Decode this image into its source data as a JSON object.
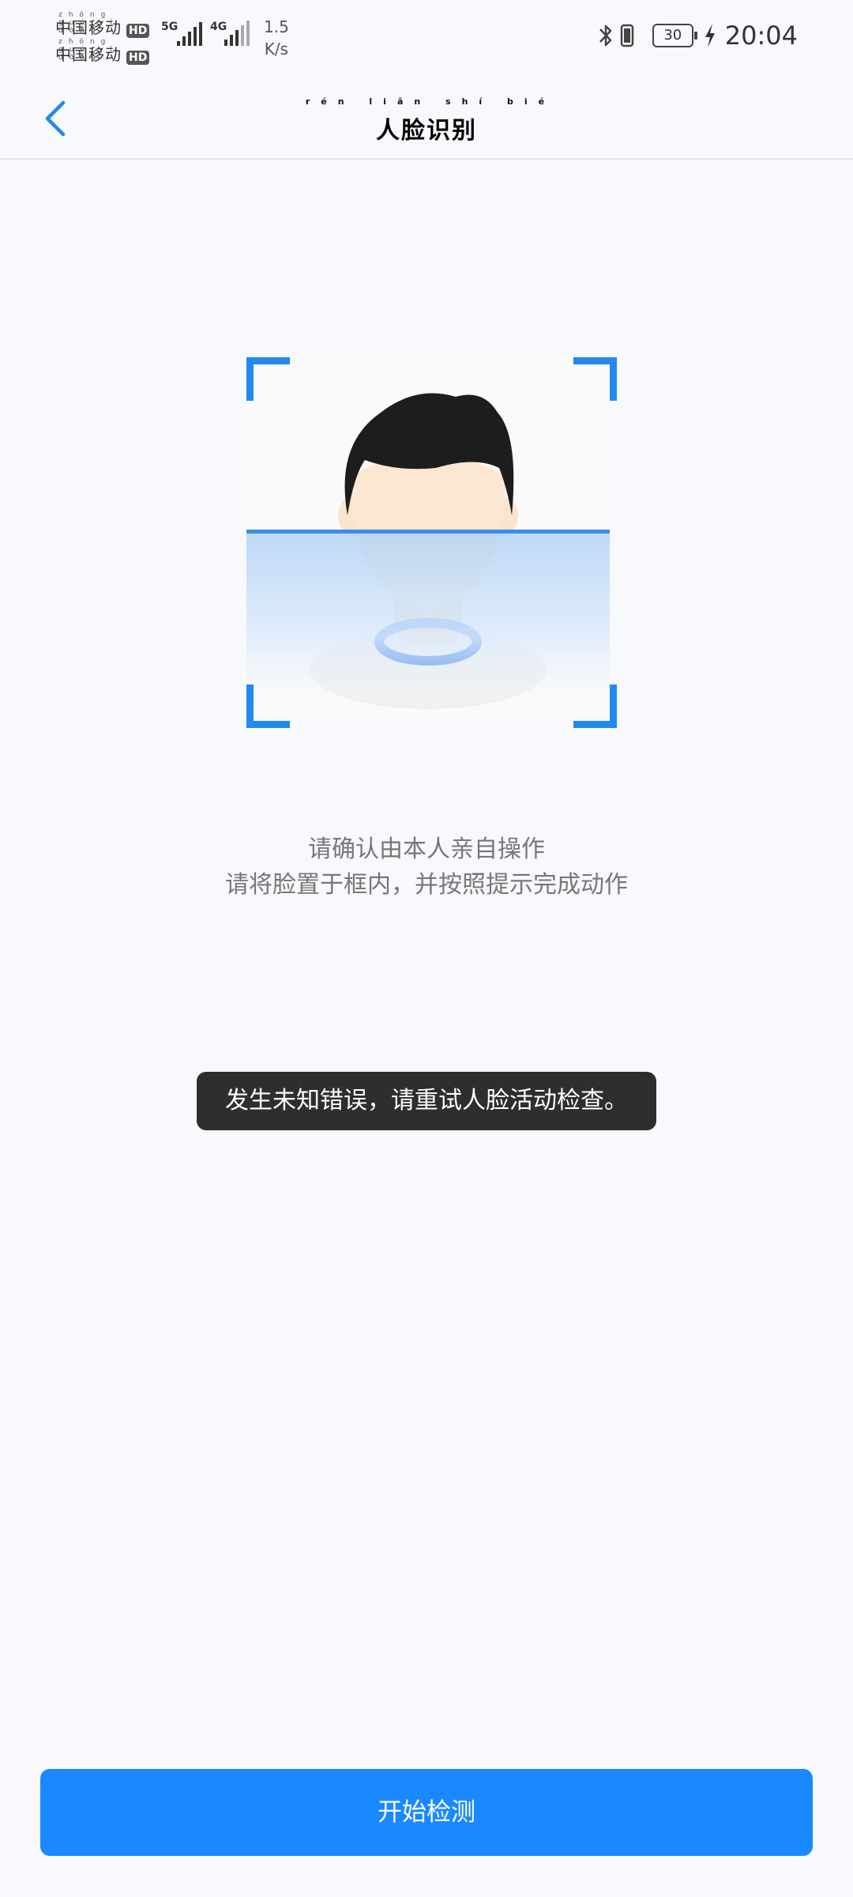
{
  "status_bar": {
    "carrier_1": "中国移动",
    "carrier_1_pinyin": "zhōng guó yí dòng",
    "carrier_2": "中国移动",
    "carrier_2_pinyin": "zhōng guó yí dòng",
    "hd_badge": "HD",
    "network_1": "5G",
    "network_2": "4G",
    "speed_value": "1.5",
    "speed_unit": "K/s",
    "battery_level": "30",
    "time": "20:04",
    "icons": [
      "bluetooth-icon",
      "vibrate-icon",
      "battery-icon",
      "charging-icon"
    ]
  },
  "nav": {
    "title": "人脸识别",
    "title_pinyin": "rén liǎn shí bié",
    "back_icon": "chevron-left-icon"
  },
  "face_frame": {
    "illustration": "face-outline-illustration",
    "accent_color": "#2189f0"
  },
  "instructions": {
    "line_1": "请确认由本人亲自操作",
    "line_2": "请将脸置于框内，并按照提示完成动作"
  },
  "toast": {
    "message": "发生未知错误，请重试人脸活动检查。"
  },
  "actions": {
    "start_label": "开始检测",
    "start_color": "#1a89ff"
  }
}
